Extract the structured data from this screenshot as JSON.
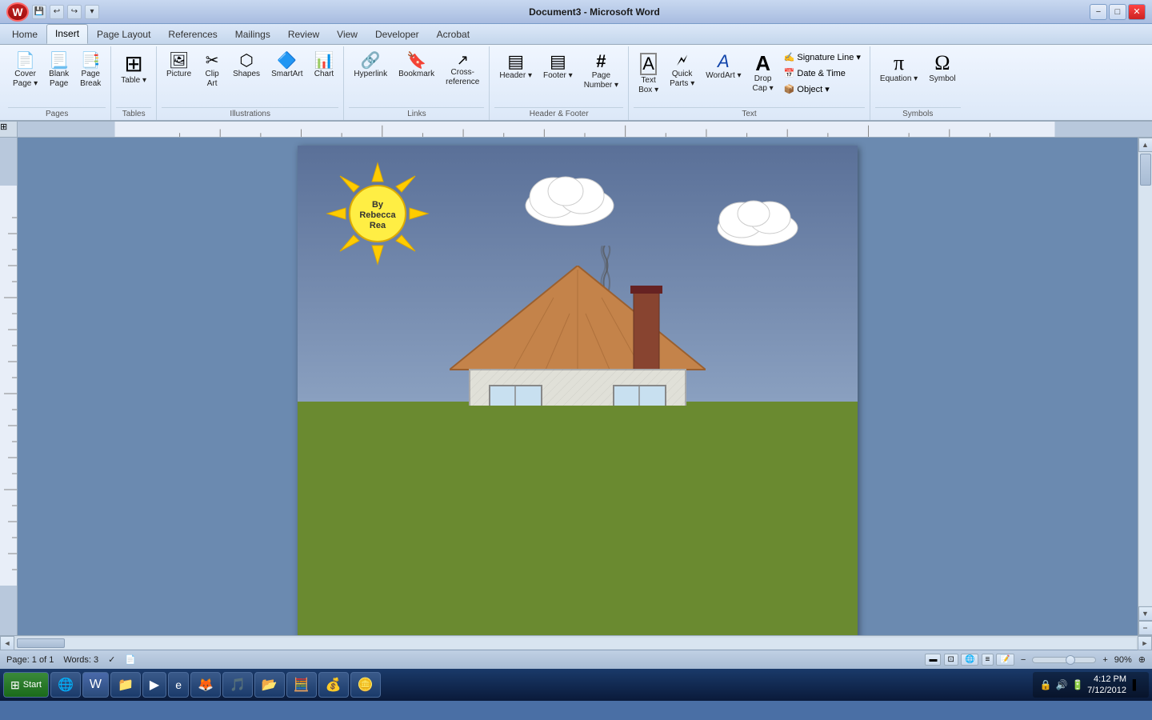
{
  "titlebar": {
    "title": "Document3 - Microsoft Word",
    "min_label": "−",
    "max_label": "□",
    "close_label": "✕",
    "office_label": "W"
  },
  "tabs": {
    "items": [
      "Home",
      "Insert",
      "Page Layout",
      "References",
      "Mailings",
      "Review",
      "View",
      "Developer",
      "Acrobat"
    ],
    "active": "Insert"
  },
  "ribbon": {
    "groups": [
      {
        "label": "Pages",
        "items": [
          {
            "id": "cover-page",
            "icon": "📄",
            "label": "Cover\nPage"
          },
          {
            "id": "blank-page",
            "icon": "📃",
            "label": "Blank\nPage"
          },
          {
            "id": "page-break",
            "icon": "📑",
            "label": "Page\nBreak"
          }
        ]
      },
      {
        "label": "Tables",
        "items": [
          {
            "id": "table",
            "icon": "⊞",
            "label": "Table"
          }
        ]
      },
      {
        "label": "Illustrations",
        "items": [
          {
            "id": "picture",
            "icon": "🖼",
            "label": "Picture"
          },
          {
            "id": "clip-art",
            "icon": "✂",
            "label": "Clip\nArt"
          },
          {
            "id": "shapes",
            "icon": "⬡",
            "label": "Shapes"
          },
          {
            "id": "smartart",
            "icon": "🔷",
            "label": "SmartArt"
          },
          {
            "id": "chart",
            "icon": "📊",
            "label": "Chart"
          }
        ]
      },
      {
        "label": "Links",
        "items": [
          {
            "id": "hyperlink",
            "icon": "🔗",
            "label": "Hyperlink"
          },
          {
            "id": "bookmark",
            "icon": "🔖",
            "label": "Bookmark"
          },
          {
            "id": "cross-ref",
            "icon": "↗",
            "label": "Cross-reference"
          }
        ]
      },
      {
        "label": "Header & Footer",
        "items": [
          {
            "id": "header",
            "icon": "▤",
            "label": "Header"
          },
          {
            "id": "footer",
            "icon": "▤",
            "label": "Footer"
          },
          {
            "id": "page-number",
            "icon": "#",
            "label": "Page\nNumber"
          }
        ]
      },
      {
        "label": "Text",
        "items": [
          {
            "id": "text-box",
            "icon": "⬜",
            "label": "Text\nBox"
          },
          {
            "id": "quick-parts",
            "icon": "🗲",
            "label": "Quick\nParts ▾"
          },
          {
            "id": "wordart",
            "icon": "A",
            "label": "WordArt"
          },
          {
            "id": "drop-cap",
            "icon": "A",
            "label": "Drop\nCap"
          },
          {
            "id": "sig-line",
            "icon": "✍",
            "label": "Signature Line ▾"
          },
          {
            "id": "date-time",
            "icon": "📅",
            "label": "Date & Time"
          },
          {
            "id": "object",
            "icon": "📦",
            "label": "Object ▾"
          }
        ]
      },
      {
        "label": "Symbols",
        "items": [
          {
            "id": "equation",
            "icon": "π",
            "label": "Equation"
          },
          {
            "id": "symbol",
            "icon": "Ω",
            "label": "Symbol"
          }
        ]
      }
    ]
  },
  "document": {
    "sun_text_line1": "By",
    "sun_text_line2": "Rebecca",
    "sun_text_line3": "Rea"
  },
  "status_bar": {
    "page_info": "Page: 1 of 1",
    "words": "Words: 3",
    "zoom_level": "90%",
    "date": "7/12/2012",
    "time": "4:12 PM"
  },
  "taskbar": {
    "start_label": "Start",
    "items": [
      "IE",
      "Word",
      "Explorer",
      "Media",
      "Browser",
      "Firefox",
      "Music",
      "Files",
      "Calc",
      "Money",
      "Coins"
    ]
  }
}
